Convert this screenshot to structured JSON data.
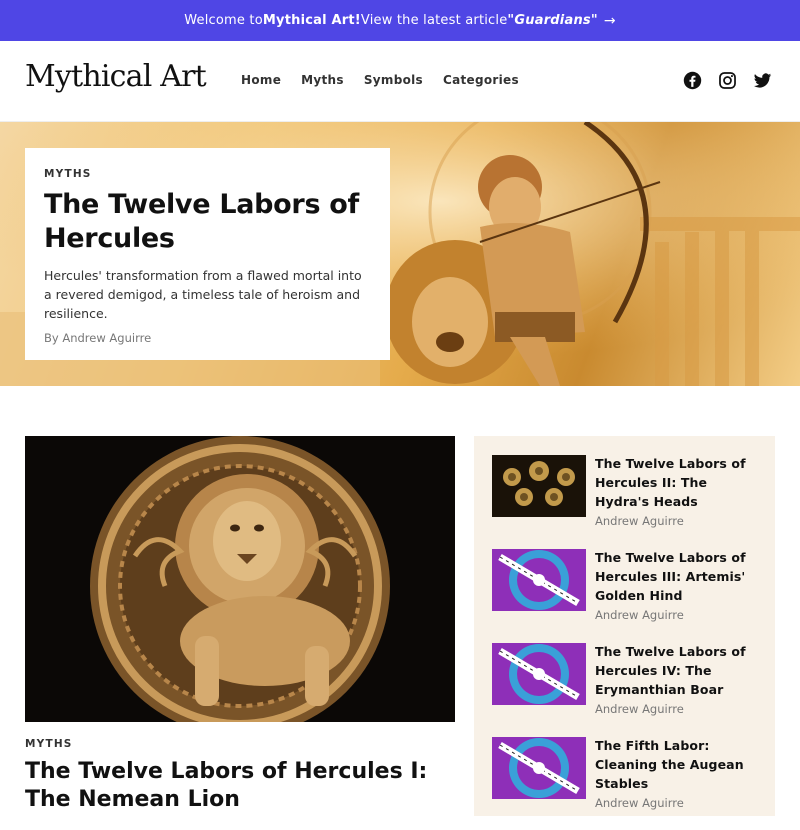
{
  "announcement": {
    "prefix": "Welcome to ",
    "brand": "Mythical Art!",
    "middle": " View the latest article ",
    "article": "\"Guardians\"",
    "arrow_icon": "arrow-right-icon"
  },
  "header": {
    "logo": "Mythical Art",
    "nav": [
      "Home",
      "Myths",
      "Symbols",
      "Categories"
    ],
    "social": [
      "facebook-icon",
      "instagram-icon",
      "twitter-icon"
    ]
  },
  "hero": {
    "category": "MYTHS",
    "title": "The Twelve Labors of Hercules",
    "description": "Hercules' transformation from a flawed mortal into a revered demigod, a timeless tale of heroism and resilience.",
    "byline": "By Andrew Aguirre"
  },
  "feature": {
    "category": "MYTHS",
    "title": "The Twelve Labors of Hercules I: The Nemean Lion"
  },
  "sidebar": {
    "items": [
      {
        "title": "The Twelve Labors of Hercules II: The Hydra's Heads",
        "author": "Andrew Aguirre",
        "thumb": "hydra"
      },
      {
        "title": "The Twelve Labors of Hercules III: Artemis' Golden Hind",
        "author": "Andrew Aguirre",
        "thumb": "placeholder"
      },
      {
        "title": "The Twelve Labors of Hercules IV: The Erymanthian Boar",
        "author": "Andrew Aguirre",
        "thumb": "placeholder"
      },
      {
        "title": "The Fifth Labor: Cleaning the Augean Stables",
        "author": "Andrew Aguirre",
        "thumb": "placeholder"
      }
    ]
  },
  "colors": {
    "announcement_bg": "#4f46e5",
    "sidebar_bg": "#f8f1e7"
  }
}
